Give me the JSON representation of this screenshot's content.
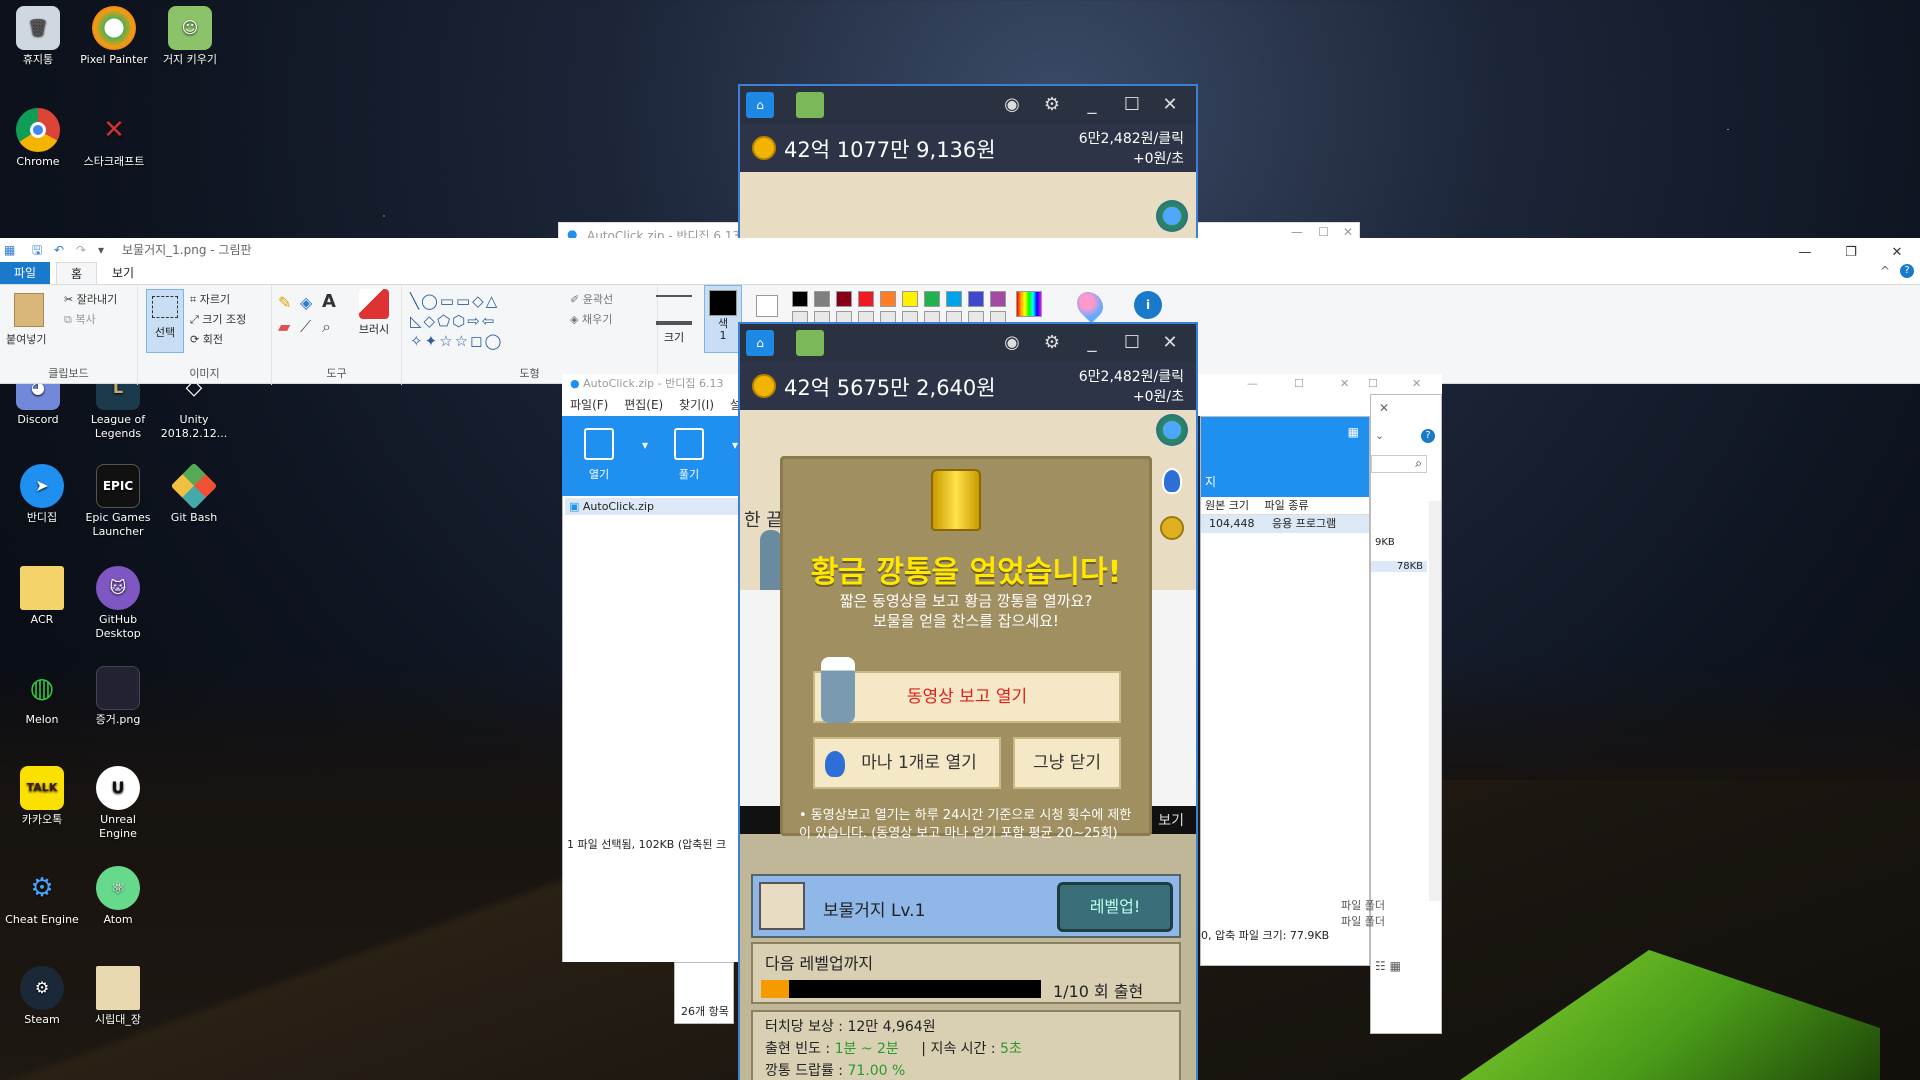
{
  "desktop": {
    "icons": [
      {
        "label": "휴지통",
        "icon": "recycle-bin-icon"
      },
      {
        "label": "Pixel Painter",
        "icon": "pixel-painter-icon"
      },
      {
        "label": "거지 키우기",
        "icon": "beggar-game-icon"
      },
      {
        "label": "Chrome",
        "icon": "chrome-icon"
      },
      {
        "label": "스타크래프트",
        "icon": "starcraft-icon"
      },
      {
        "label": "Discord",
        "icon": "discord-icon"
      },
      {
        "label": "League of Legends",
        "icon": "league-icon"
      },
      {
        "label": "Unity 2018.2.12...",
        "icon": "unity-icon"
      },
      {
        "label": "반디집",
        "icon": "bandizip-icon"
      },
      {
        "label": "Epic Games Launcher",
        "icon": "epic-icon"
      },
      {
        "label": "Git Bash",
        "icon": "git-bash-icon"
      },
      {
        "label": "ACR",
        "icon": "folder-icon"
      },
      {
        "label": "GitHub Desktop",
        "icon": "github-icon"
      },
      {
        "label": "Melon",
        "icon": "melon-icon"
      },
      {
        "label": "증거.png",
        "icon": "image-file-icon"
      },
      {
        "label": "카카오톡",
        "icon": "kakaotalk-icon"
      },
      {
        "label": "Unreal Engine",
        "icon": "unreal-icon"
      },
      {
        "label": "Cheat Engine",
        "icon": "cheat-engine-icon"
      },
      {
        "label": "Atom",
        "icon": "atom-icon"
      },
      {
        "label": "Steam",
        "icon": "steam-icon"
      },
      {
        "label": "시립대_장",
        "icon": "file-icon"
      }
    ],
    "badge_talk": "TALK",
    "badge_epic": "EPIC"
  },
  "paint": {
    "title": "보물거지_1.png - 그림판",
    "tabs": [
      "파일",
      "홈",
      "보기"
    ],
    "clipboard": {
      "paste": "붙여넣기",
      "cut": "잘라내기",
      "copy": "복사",
      "group": "클립보드"
    },
    "image": {
      "select": "선택",
      "crop": "자르기",
      "resize": "크기 조정",
      "rotate": "회전",
      "group": "이미지"
    },
    "tools": {
      "group": "도구",
      "brushes": "브러시"
    },
    "shapes": {
      "outline": "윤곽선",
      "fill": "채우기",
      "group": "도형"
    },
    "size": "크기",
    "color1": "색\n1",
    "text_tool": "A",
    "info_glyph": "i",
    "help_glyph": "?",
    "collapse_glyph": "^",
    "palette": [
      "#000000",
      "#7f7f7f",
      "#880015",
      "#ed1c24",
      "#ff7f27",
      "#fff200",
      "#22b14c",
      "#00a2e8",
      "#3f48cc",
      "#a349a4"
    ]
  },
  "bandizip_back": {
    "title": "AutoClick.zip - 반디집 6.13"
  },
  "bandizip_front": {
    "title": "AutoClick.zip - 반디집 6.13",
    "menu": [
      "파일(F)",
      "편집(E)",
      "찾기(I)",
      "설"
    ],
    "tools": [
      "열기",
      "풀기"
    ],
    "file": "AutoClick.zip",
    "status": "1 파일 선택됨, 102KB (압축된 크",
    "columns": [
      "원본 크기",
      "파일 종류"
    ],
    "row": {
      "size": "104,448",
      "type": "응용 프로그램"
    },
    "sizes": [
      "9KB",
      "78KB"
    ],
    "status_right": "0, 압축 파일 크기: 77.9KB",
    "behind_items": [
      "파일 폴더",
      "파일 폴더"
    ],
    "count": "26개 항목",
    "partial_label": "지",
    "partial_tab": "보기",
    "touch_label_partial": "한 끝"
  },
  "game_top": {
    "money": "42억 1077만 9,136원",
    "per_click": "6만2,482원/클릭",
    "per_sec": "+0원/초"
  },
  "game_front": {
    "money": "42억 5675만 2,640원",
    "per_click": "6만2,482원/클릭",
    "per_sec": "+0원/초",
    "modal": {
      "title": "황금 깡통을 얻었습니다!",
      "subtitle1": "짧은 동영상을 보고 황금 깡통을 열까요?",
      "subtitle2": "보물을 얻을 찬스를 잡으세요!",
      "btn_video": "동영상 보고 열기",
      "btn_mana": "마나 1개로 열기",
      "btn_close": "그냥 닫기",
      "note": "• 동영상보고 열기는 하루 24시간 기준으로 시청 횟수에 제한이 있습니다. (동영상 보고 마나 얻기 포함 평균 20~25회)"
    },
    "level": {
      "name": "보물거지 Lv.1",
      "button": "레벨업!",
      "next_label": "다음 레벨업까지",
      "progress_text": "1/10 회 출현",
      "progress": 0.1
    },
    "info": {
      "reward_label": "터치당 보상 : ",
      "reward": "12만 4,964원",
      "freq_label": "출현 빈도 : ",
      "freq": "1분 ~ 2분",
      "dur_label": "지속 시간 : ",
      "dur": "5초",
      "drop_label": "깡통 드랍률 : ",
      "drop": "71.00 %"
    }
  }
}
